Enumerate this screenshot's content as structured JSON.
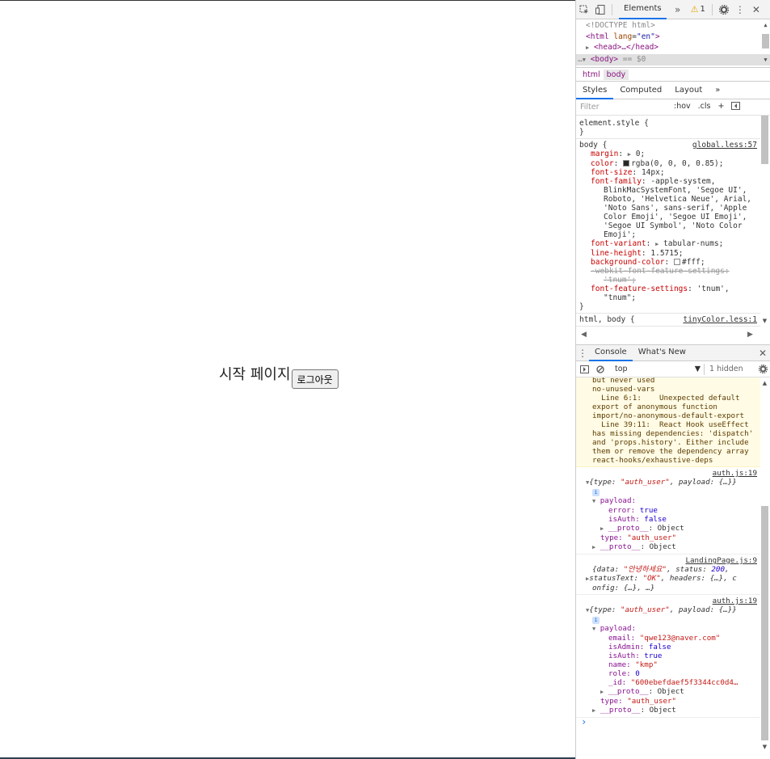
{
  "app": {
    "title": "시작 페이지",
    "logout_label": "로그아웃"
  },
  "devtools": {
    "toolbar": {
      "inspect_icon": "inspect-icon",
      "device_icon": "device-toggle-icon",
      "elements_tab": "Elements",
      "more_tabs": "»",
      "warning_count": "1",
      "settings_icon": "gear-icon",
      "menu_icon": "kebab-menu-icon",
      "close": "✕"
    },
    "dom": {
      "doctype": "<!DOCTYPE html>",
      "html_open": "<html",
      "html_attr_name": "lang",
      "html_attr_value": "\"en\"",
      "head": "<head>…</head>",
      "body": "<body>",
      "body_suffix": "== $0",
      "dots": "…"
    },
    "breadcrumb": [
      "html",
      "body"
    ],
    "subtabs": [
      "Styles",
      "Computed",
      "Layout",
      "»"
    ],
    "filter": {
      "placeholder": "Filter",
      "hov": ":hov",
      "cls": ".cls",
      "plus": "+"
    },
    "styles": {
      "element_style_open": "element.style {",
      "close_brace": "}",
      "body_selector": "body {",
      "body_source": "global.less:57",
      "margin_name": "margin",
      "margin_value": "0;",
      "color_name": "color",
      "color_value": "rgba(0, 0, 0, 0.85);",
      "font_size_name": "font-size",
      "font_size_value": "14px;",
      "font_family_name": "font-family",
      "font_family_lines": [
        "-apple-system,",
        "BlinkMacSystemFont, 'Segoe UI',",
        "Roboto, 'Helvetica Neue', Arial,",
        "'Noto Sans', sans-serif, 'Apple",
        "Color Emoji', 'Segoe UI Emoji',",
        "'Segoe UI Symbol', 'Noto Color",
        "Emoji';"
      ],
      "font_variant_name": "font-variant",
      "font_variant_value": "tabular-nums;",
      "line_height_name": "line-height",
      "line_height_value": "1.5715;",
      "bg_name": "background-color",
      "bg_value": "#fff;",
      "webkit_ff_line1": "-webkit-font-feature-settings:",
      "webkit_ff_line2": "'tnum';",
      "ff_name": "font-feature-settings",
      "ff_value1": "'tnum',",
      "ff_value2": "\"tnum\";",
      "next_selector": "html, body {",
      "next_source": "tinyColor.less:1"
    },
    "drawer": {
      "tabs": [
        "Console",
        "What's New"
      ],
      "close": "✕"
    },
    "console_toolbar": {
      "context": "top",
      "hidden": "1 hidden"
    },
    "console": {
      "warning_lines": [
        "but never used",
        "no-unused-vars",
        "  Line 6:1:    Unexpected default",
        "export of anonymous function",
        "import/no-anonymous-default-export",
        "  Line 39:11:  React Hook useEffect",
        "has missing dependencies: 'dispatch'",
        "and 'props.history'. Either include",
        "them or remove the dependency array",
        "react-hooks/exhaustive-deps"
      ],
      "log1": {
        "source": "auth.js:19",
        "summary_pre": "{type: ",
        "summary_type": "\"auth_user\"",
        "summary_post": ", payload: {…}}",
        "payload_key": "payload:",
        "error_key": "error:",
        "error_val": "true",
        "isauth_key": "isAuth:",
        "isauth_val": "false",
        "proto1": "__proto__",
        "proto1_val": ": Object",
        "type_key": "type:",
        "type_val": "\"auth_user\"",
        "proto2": "__proto__",
        "proto2_val": ": Object"
      },
      "log2": {
        "source": "LandingPage.js:9",
        "line1_pre": "{data: ",
        "line1_data": "\"안녕하세요\"",
        "line1_mid": ", status: ",
        "line1_status": "200",
        "line1_post": ",",
        "line2_pre": "statusText: ",
        "line2_st": "\"OK\"",
        "line2_post": ", headers: {…}, c",
        "line3": "onfig: {…}, …}"
      },
      "log3": {
        "source": "auth.js:19",
        "summary_pre": "{type: ",
        "summary_type": "\"auth_user\"",
        "summary_post": ", payload: {…}}",
        "payload_key": "payload:",
        "email_key": "email:",
        "email_val": "\"qwe123@naver.com\"",
        "isadmin_key": "isAdmin:",
        "isadmin_val": "false",
        "isauth_key": "isAuth:",
        "isauth_val": "true",
        "name_key": "name:",
        "name_val": "\"kmp\"",
        "role_key": "role:",
        "role_val": "0",
        "id_key": "_id:",
        "id_val": "\"600ebefdaef5f3344cc0d4…",
        "proto1": "__proto__",
        "proto1_val": ": Object",
        "type_key": "type:",
        "type_val": "\"auth_user\"",
        "proto2": "__proto__",
        "proto2_val": ": Object"
      },
      "prompt": "›"
    }
  }
}
